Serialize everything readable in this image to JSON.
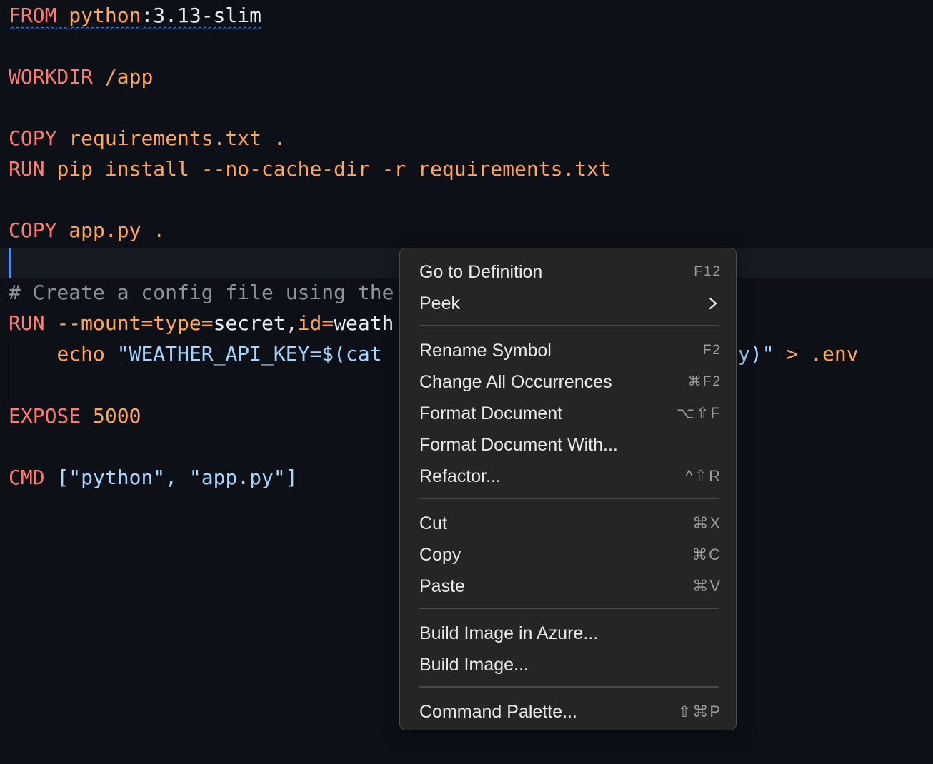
{
  "editor": {
    "lines": {
      "l1": {
        "kw": "FROM",
        "image": "python",
        "tag": ":3.13-slim"
      },
      "l2": {
        "kw": "WORKDIR",
        "arg": "/app"
      },
      "l3": {
        "kw": "COPY",
        "arg": "requirements.txt ."
      },
      "l4": {
        "kw": "RUN",
        "arg": "pip install --no-cache-dir -r requirements.txt"
      },
      "l5": {
        "kw": "COPY",
        "arg": "app.py ."
      },
      "l6": {
        "comment": "# Create a config file using the"
      },
      "l7": {
        "kw": "RUN",
        "opt1": "--mount=type=",
        "val1": "secret,",
        "opt2": "id=",
        "val2": "weath"
      },
      "l8": {
        "indent": "    ",
        "cmd": "echo ",
        "str": "\"WEATHER_API_KEY=$(cat",
        "tail_str": "y)\"",
        "tail_rest": " > .env"
      },
      "l9": {
        "kw": "EXPOSE",
        "num": "5000"
      },
      "l10": {
        "kw": "CMD",
        "str": "[\"python\", \"app.py\"]"
      }
    }
  },
  "context_menu": {
    "items": [
      {
        "label": "Go to Definition",
        "shortcut": "F12"
      },
      {
        "label": "Peek",
        "shortcut": ""
      },
      {
        "label": "Rename Symbol",
        "shortcut": "F2"
      },
      {
        "label": "Change All Occurrences",
        "shortcut": "⌘F2"
      },
      {
        "label": "Format Document",
        "shortcut": "⌥⇧F"
      },
      {
        "label": "Format Document With...",
        "shortcut": ""
      },
      {
        "label": "Refactor...",
        "shortcut": "^⇧R"
      },
      {
        "label": "Cut",
        "shortcut": "⌘X"
      },
      {
        "label": "Copy",
        "shortcut": "⌘C"
      },
      {
        "label": "Paste",
        "shortcut": "⌘V"
      },
      {
        "label": "Build Image in Azure...",
        "shortcut": ""
      },
      {
        "label": "Build Image...",
        "shortcut": ""
      },
      {
        "label": "Command Palette...",
        "shortcut": "⇧⌘P"
      }
    ],
    "peek_icon": "chevron-right-icon"
  },
  "colors": {
    "background": "#0d1117",
    "keyword": "#ff7b72",
    "argument": "#ffa657",
    "string": "#a5d6ff",
    "comment": "#8b949e",
    "cursor": "#4493f8",
    "menu_background": "#252526"
  }
}
